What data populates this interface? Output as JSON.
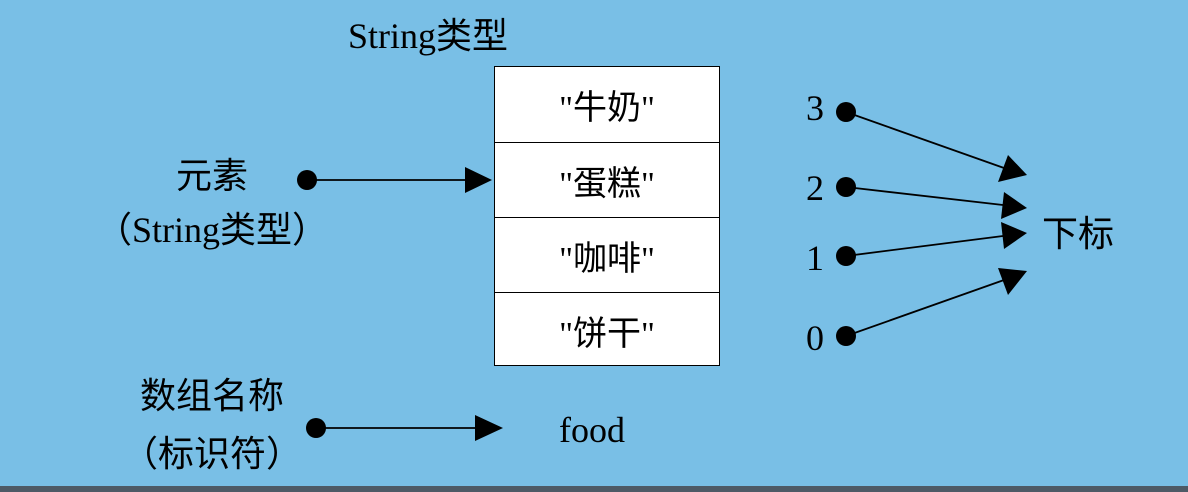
{
  "array_type_label": "String类型",
  "cells": [
    "\"牛奶\"",
    "\"蛋糕\"",
    "\"咖啡\"",
    "\"饼干\""
  ],
  "element_label": {
    "line1": "元素",
    "line2": "（String类型）"
  },
  "array_name_label": {
    "line1": "数组名称",
    "line2": "（标识符）"
  },
  "array_name": "food",
  "index_label": "下标",
  "indices": [
    "3",
    "2",
    "1",
    "0"
  ],
  "colors": {
    "background": "#79bfe6",
    "box_fill": "#ffffff",
    "ink": "#000000"
  }
}
